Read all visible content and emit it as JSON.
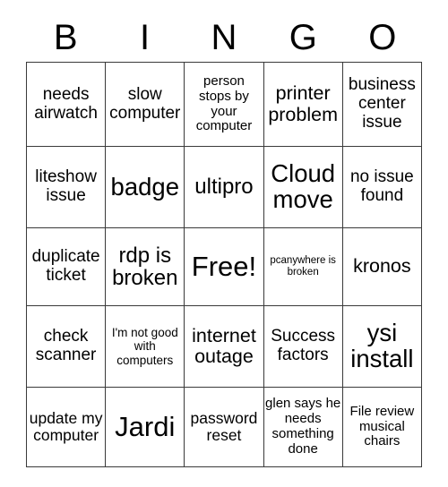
{
  "title": "BINGO Card",
  "header": {
    "letters": [
      "B",
      "I",
      "N",
      "G",
      "O"
    ]
  },
  "colors": {
    "background": "#ffffff",
    "text": "#000000",
    "grid_line": "#3a3a3a"
  },
  "grid": {
    "columns": 5,
    "rows": 5,
    "free_space": {
      "row": 3,
      "column": 3,
      "label": "Free!"
    },
    "cells": [
      [
        {
          "text": "needs airwatch",
          "size": "fs-19"
        },
        {
          "text": "slow computer",
          "size": "fs-19"
        },
        {
          "text": "person stops by your computer",
          "size": "fs-15"
        },
        {
          "text": "printer problem",
          "size": "fs-21"
        },
        {
          "text": "business center issue",
          "size": "fs-19"
        }
      ],
      [
        {
          "text": "liteshow issue",
          "size": "fs-19"
        },
        {
          "text": "badge",
          "size": "fs-27"
        },
        {
          "text": "ultipro",
          "size": "fs-24"
        },
        {
          "text": "Cloud move",
          "size": "fs-27"
        },
        {
          "text": "no issue found",
          "size": "fs-19"
        }
      ],
      [
        {
          "text": "duplicate ticket",
          "size": "fs-19"
        },
        {
          "text": "rdp is broken",
          "size": "fs-24"
        },
        {
          "text": "Free!",
          "size": "fs-31"
        },
        {
          "text": "pcanywhere is broken",
          "size": "fs-11"
        },
        {
          "text": "kronos",
          "size": "fs-21"
        }
      ],
      [
        {
          "text": "check scanner",
          "size": "fs-19"
        },
        {
          "text": "I'm not good with computers",
          "size": "fs-13"
        },
        {
          "text": "internet outage",
          "size": "fs-21"
        },
        {
          "text": "Success factors",
          "size": "fs-19"
        },
        {
          "text": "ysi install",
          "size": "fs-27"
        }
      ],
      [
        {
          "text": "update my computer",
          "size": "fs-17"
        },
        {
          "text": "Jardi",
          "size": "fs-31"
        },
        {
          "text": "password reset",
          "size": "fs-17"
        },
        {
          "text": "glen says he needs something done",
          "size": "fs-15"
        },
        {
          "text": "File review musical chairs",
          "size": "fs-15"
        }
      ]
    ]
  }
}
